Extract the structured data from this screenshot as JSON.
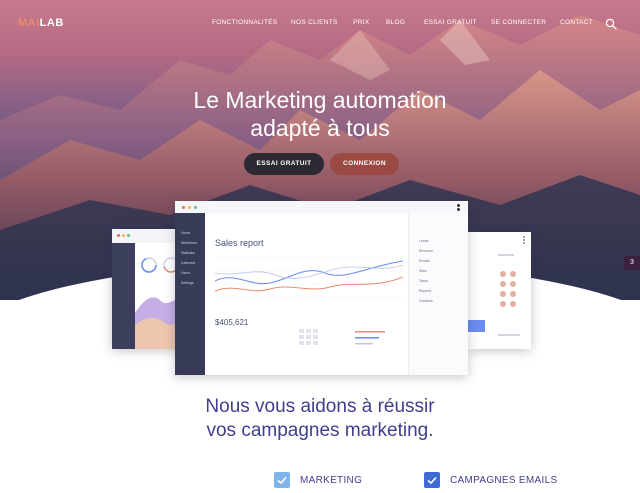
{
  "brand": {
    "logo_prefix": "MAI",
    "logo_suffix": "LAB"
  },
  "nav": {
    "items": [
      "FONCTIONNALITÉS",
      "NOS CLIENTS",
      "PRIX",
      "BLOG",
      "ESSAI GRATUIT",
      "SE CONNECTER",
      "CONTACT"
    ],
    "search_icon": "search-icon"
  },
  "hero": {
    "headline_line1": "Le Marketing automation",
    "headline_line2": "adapté à tous",
    "cta_trial": "ESSAI GRATUIT",
    "cta_login": "CONNEXION"
  },
  "side_badge": "3",
  "dashboard": {
    "title": "Sales report",
    "total": "$405,621",
    "sidebar_items": [
      "Home",
      "Workflows",
      "Statistics",
      "Calendar",
      "Users",
      "Settings"
    ],
    "right_items": [
      "Leads",
      "Revenue",
      "Emails",
      "Sites",
      "Tasks",
      "Reports",
      "Contacts"
    ]
  },
  "colors": {
    "accent": "#e88a70",
    "brand_text": "#3f3f8e",
    "check_light": "#7fb4e8",
    "check_dark": "#3d6bd6"
  },
  "tagline": {
    "line1": "Nous vous aidons à réussir",
    "line2": "vos campagnes marketing."
  },
  "features": [
    {
      "label": "MARKETING"
    },
    {
      "label": "CAMPAGNES EMAILS"
    }
  ]
}
